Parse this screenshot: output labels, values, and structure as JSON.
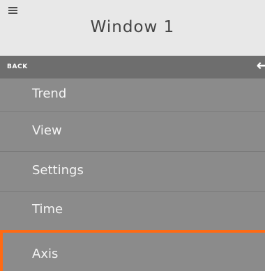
{
  "header": {
    "title": "Window 1",
    "menu_icon": "hamburger-icon"
  },
  "menu": {
    "back_label": "BACK",
    "back_icon": "arrow-left-icon",
    "items": [
      {
        "label": "Trend"
      },
      {
        "label": "View"
      },
      {
        "label": "Settings"
      },
      {
        "label": "Time"
      },
      {
        "label": "Axis",
        "active": true
      }
    ]
  },
  "colors": {
    "header_bg": "#e8e8e8",
    "menu_bg": "#8b8b8b",
    "back_bg": "#6e6e6e",
    "active_border": "#ff6a13"
  }
}
